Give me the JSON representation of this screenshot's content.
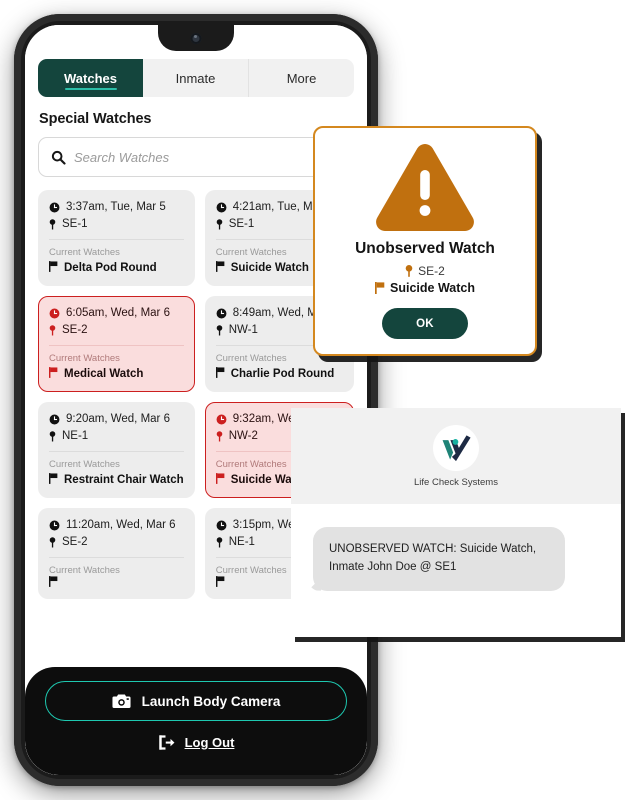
{
  "app": {
    "tabs": [
      {
        "label": "Watches",
        "active": true
      },
      {
        "label": "Inmate",
        "active": false
      },
      {
        "label": "More",
        "active": false
      }
    ],
    "section_title": "Special Watches",
    "search": {
      "placeholder": "Search Watches",
      "value": "",
      "icon": "search-icon"
    },
    "cards": [
      {
        "time": "3:37am, Tue, Mar 5",
        "location": "SE-1",
        "sub_label": "Current Watches",
        "watch_name": "Delta Pod Round",
        "alert": false
      },
      {
        "time": "4:21am, Tue, Mar 5",
        "location": "SE-1",
        "sub_label": "Current Watches",
        "watch_name": "Suicide Watch",
        "alert": false
      },
      {
        "time": "6:05am, Wed, Mar 6",
        "location": "SE-2",
        "sub_label": "Current Watches",
        "watch_name": "Medical Watch",
        "alert": true
      },
      {
        "time": "8:49am, Wed, Mar 6",
        "location": "NW-1",
        "sub_label": "Current Watches",
        "watch_name": "Charlie Pod Round",
        "alert": false
      },
      {
        "time": "9:20am, Wed, Mar 6",
        "location": "NE-1",
        "sub_label": "Current Watches",
        "watch_name": "Restraint Chair Watch",
        "alert": false
      },
      {
        "time": "9:32am, Wed, Mar 6",
        "location": "NW-2",
        "sub_label": "Current Watches",
        "watch_name": "Suicide Watch",
        "alert": true
      },
      {
        "time": "11:20am, Wed, Mar 6",
        "location": "SE-2",
        "sub_label": "Current Watches",
        "watch_name": "",
        "alert": false
      },
      {
        "time": "3:15pm, Wed, Mar 6",
        "location": "NE-1",
        "sub_label": "Current Watches",
        "watch_name": "",
        "alert": false
      }
    ],
    "action_bar": {
      "camera_label": "Launch Body Camera",
      "camera_icon": "camera-icon",
      "logout_label": "Log Out",
      "logout_icon": "logout-icon"
    }
  },
  "alert_dialog": {
    "icon": "warning-triangle-icon",
    "title": "Unobserved Watch",
    "location": "SE-2",
    "watch_name": "Suicide Watch",
    "ok_label": "OK"
  },
  "notification": {
    "logo_icon": "life-check-systems-logo",
    "brand": "Life Check Systems",
    "message": "UNOBSERVED WATCH: Suicide Watch, Inmate John Doe @ SE1"
  },
  "colors": {
    "brand_green": "#14453D",
    "accent_teal": "#1EC8B0",
    "alert_orange": "#C0700F",
    "dialog_border": "#D4881F",
    "alert_red": "#CC1F1F",
    "alert_red_bg": "#FADDDD",
    "card_bg": "#EDEDED",
    "frame_black": "#1B1B1B"
  }
}
